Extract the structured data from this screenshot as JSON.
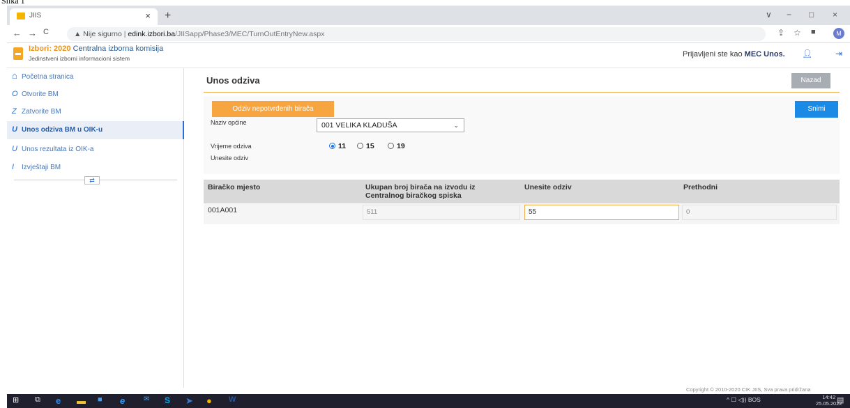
{
  "top_fragment": "Slika 1",
  "browser": {
    "tab_title": "JIIS",
    "tab_close": "×",
    "new_tab": "+",
    "window_controls": [
      "∨",
      "−",
      "□",
      "×"
    ],
    "nav": {
      "back": "←",
      "forward": "→",
      "reload": "C"
    },
    "address": {
      "warning": "▲ Nije sigurno",
      "separator": "|",
      "host": "edink.izbori.ba",
      "path": "/JIISapp/Phase3/MEC/TurnOutEntryNew.aspx"
    },
    "profile_initial": "M"
  },
  "app_header": {
    "brand_prefix": "Izbori: 2020",
    "brand_name": "Centralna izborna komisija",
    "subtitle": "Jedinstveni izborni informacioni sistem",
    "logged_in_prefix": "Prijavljeni ste kao",
    "logged_in_user": "MEC Unos."
  },
  "sidebar": {
    "items": [
      {
        "icon": "home-icon",
        "glyph": "⌂",
        "label": "Početna stranica",
        "active": false
      },
      {
        "icon": "o-icon",
        "glyph": "O",
        "label": "Otvorite BM",
        "active": false
      },
      {
        "icon": "z-icon",
        "glyph": "Z",
        "label": "Zatvorite BM",
        "active": false
      },
      {
        "icon": "u-icon",
        "glyph": "U",
        "label": "Unos odziva BM u OIK-u",
        "active": true
      },
      {
        "icon": "u-icon",
        "glyph": "U",
        "label": "Unos rezultata iz OIK-a",
        "active": false
      },
      {
        "icon": "i-icon",
        "glyph": "I",
        "label": "Izvještaji BM",
        "active": false
      }
    ],
    "collapse_glyph": "⇄"
  },
  "main": {
    "title": "Unos odziva",
    "back_label": "Nazad",
    "unconfirmed_label": "Odziv nepotvrđenih birača",
    "save_label": "Snimi",
    "municipality_label": "Naziv općine",
    "municipality_value": "001 VELIKA KLADUŠA",
    "time_label": "Vrijeme odziva",
    "enter_label": "Unesite odziv",
    "time_options": [
      {
        "label": "11",
        "selected": true
      },
      {
        "label": "15",
        "selected": false
      },
      {
        "label": "19",
        "selected": false
      }
    ]
  },
  "table": {
    "headers": [
      "Biračko mjesto",
      "Ukupan broj birača na izvodu iz Centralnog biračkog spiska",
      "Unesite odziv",
      "Prethodni"
    ],
    "rows": [
      {
        "station": "001A001",
        "total": "511",
        "turnout": "55",
        "previous": "0"
      }
    ]
  },
  "footer": {
    "copyright": "Copyright © 2010-2020 CIK JIIS, Sva prava pridržana"
  },
  "taskbar": {
    "tray_text": "^ ☐ ◁)) BOS",
    "time": "14:42",
    "date": "25.05.2022"
  }
}
